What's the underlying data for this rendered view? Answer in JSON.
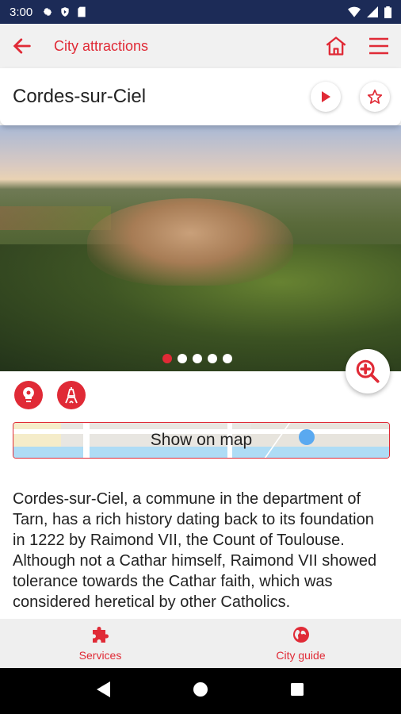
{
  "status": {
    "time": "3:00"
  },
  "app_bar": {
    "title": "City attractions"
  },
  "header": {
    "place_name": "Cordes-sur-Ciel"
  },
  "gallery": {
    "dot_count": 5,
    "active_index": 0
  },
  "map_button": {
    "label": "Show on map"
  },
  "description": "Cordes-sur-Ciel, a commune in the department of Tarn, has a rich history dating back to its foundation in 1222 by Raimond VII, the Count of Toulouse. Although not a Cathar himself, Raimond VII showed tolerance towards the Cathar faith, which was considered heretical by other Catholics.",
  "bottom_nav": [
    {
      "label": "Services",
      "icon": "puzzle-icon"
    },
    {
      "label": "City guide",
      "icon": "globe-icon"
    }
  ],
  "colors": {
    "accent": "#e02a36",
    "status_bar": "#1c2b57"
  }
}
